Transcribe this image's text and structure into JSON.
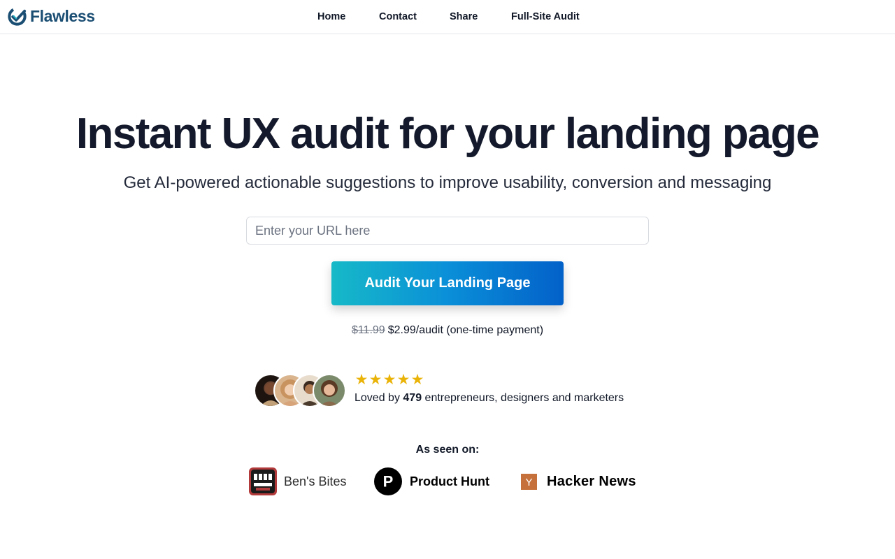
{
  "header": {
    "logo_text": "Flawless",
    "nav": [
      {
        "label": "Home"
      },
      {
        "label": "Contact"
      },
      {
        "label": "Share"
      },
      {
        "label": "Full-Site Audit"
      }
    ]
  },
  "hero": {
    "headline": "Instant UX audit for your landing page",
    "subheadline": "Get AI-powered actionable suggestions to improve usability, conversion and messaging",
    "url_input": {
      "value": "",
      "placeholder": "Enter your URL here"
    },
    "cta_label": "Audit Your Landing Page",
    "price_old": "$11.99",
    "price_new": "$2.99/audit (one-time payment)"
  },
  "social_proof": {
    "rating_stars": 5,
    "loved_prefix": "Loved by ",
    "count": "479",
    "loved_suffix": " entrepreneurs, designers and marketers"
  },
  "as_seen_on": {
    "label": "As seen on:",
    "brands": [
      {
        "name": "Ben's Bites",
        "icon": "bens-bites-logo"
      },
      {
        "name": "Product Hunt",
        "icon": "product-hunt-logo",
        "icon_letter": "P"
      },
      {
        "name": "Hacker News",
        "icon": "hacker-news-logo",
        "icon_letter": "Y"
      }
    ]
  },
  "colors": {
    "brand": "#1b4e73",
    "cta_gradient_start": "#17b9c8",
    "cta_gradient_end": "#0361c9",
    "star": "#eab308",
    "hacker_news": "#c6713b",
    "bens_bites": "#b33a3a"
  }
}
